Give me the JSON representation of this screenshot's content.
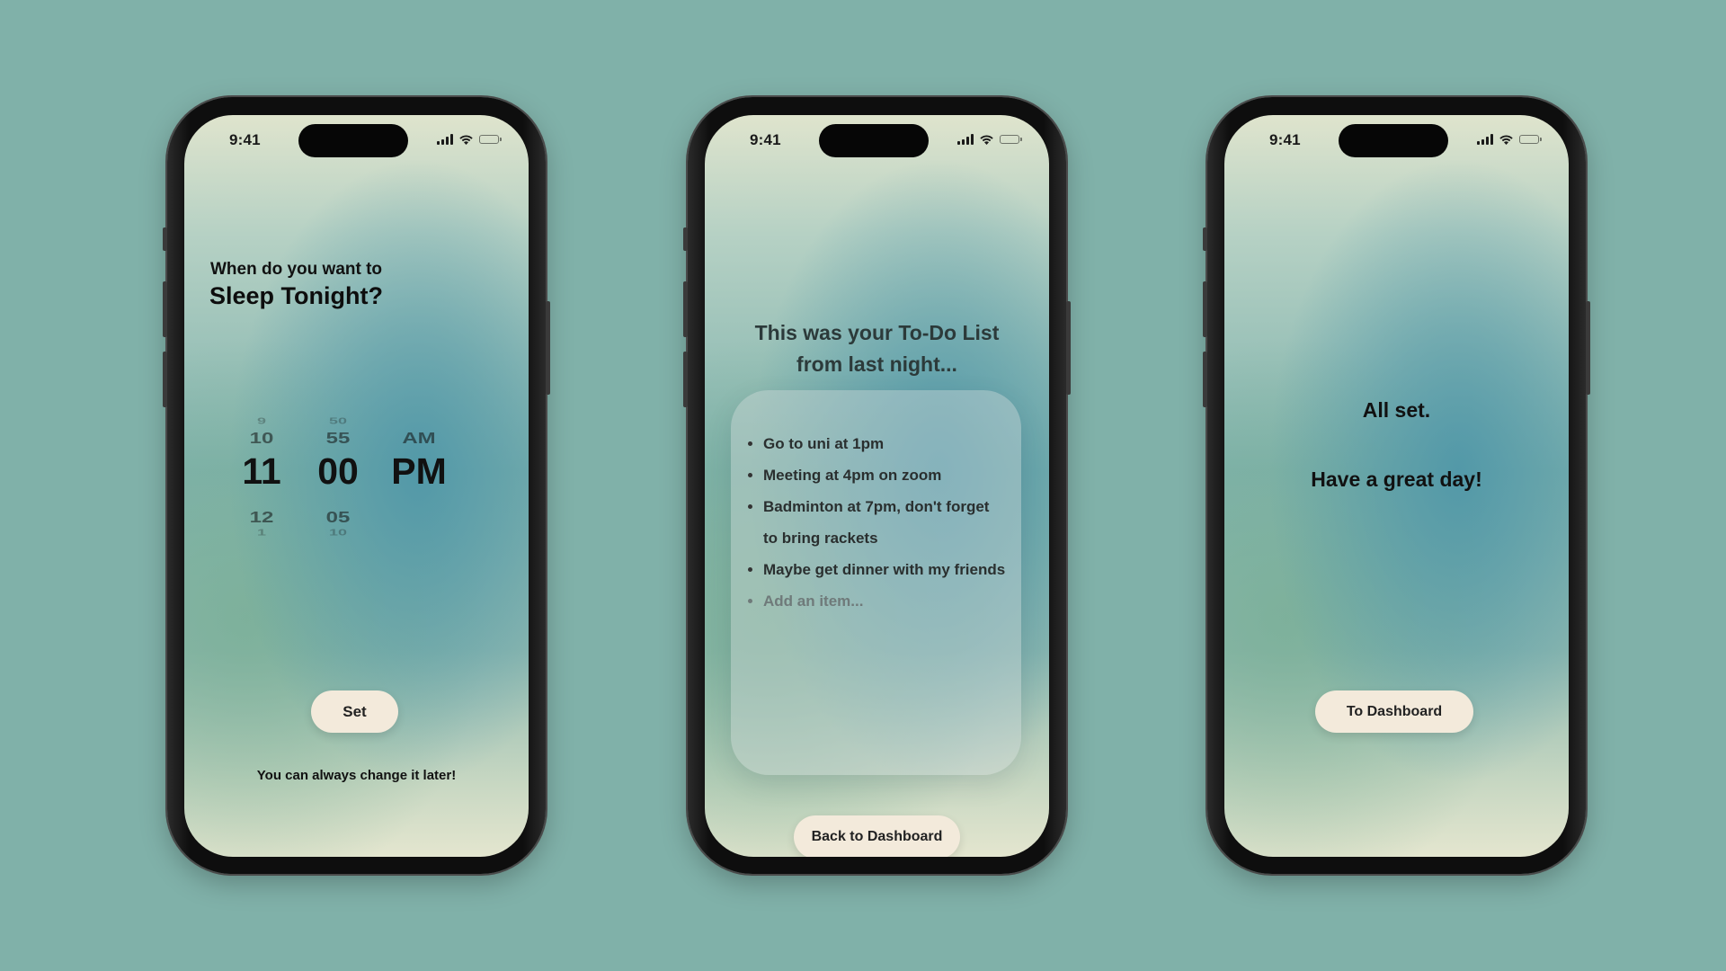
{
  "status_bar": {
    "time": "9:41"
  },
  "screen_sleep": {
    "question": "When do you want to",
    "title": "Sleep Tonight?",
    "picker": {
      "hours": [
        "9",
        "10",
        "11",
        "12",
        "1"
      ],
      "minutes": [
        "50",
        "55",
        "00",
        "05",
        "10"
      ],
      "period": [
        "AM",
        "PM"
      ],
      "selected_hour": "11",
      "selected_minute": "00",
      "selected_period": "PM"
    },
    "set_button": "Set",
    "note": "You can always change it later!"
  },
  "screen_todo": {
    "heading_line1": "This was your To-Do List",
    "heading_line2": "from last night...",
    "items": [
      "Go to uni at 1pm",
      "Meeting at 4pm on zoom",
      "Badminton at 7pm, don't forget to bring rackets",
      "Maybe get dinner with my friends"
    ],
    "add_placeholder": "Add an item...",
    "back_button": "Back to Dashboard"
  },
  "screen_done": {
    "message": "All set.",
    "greeting": "Have a great day!",
    "dashboard_button": "To Dashboard"
  },
  "colors": {
    "background": "#80b1a9",
    "button": "#f3eadb",
    "text": "#111111"
  },
  "icons": [
    "signal-icon",
    "wifi-icon",
    "battery-icon"
  ]
}
